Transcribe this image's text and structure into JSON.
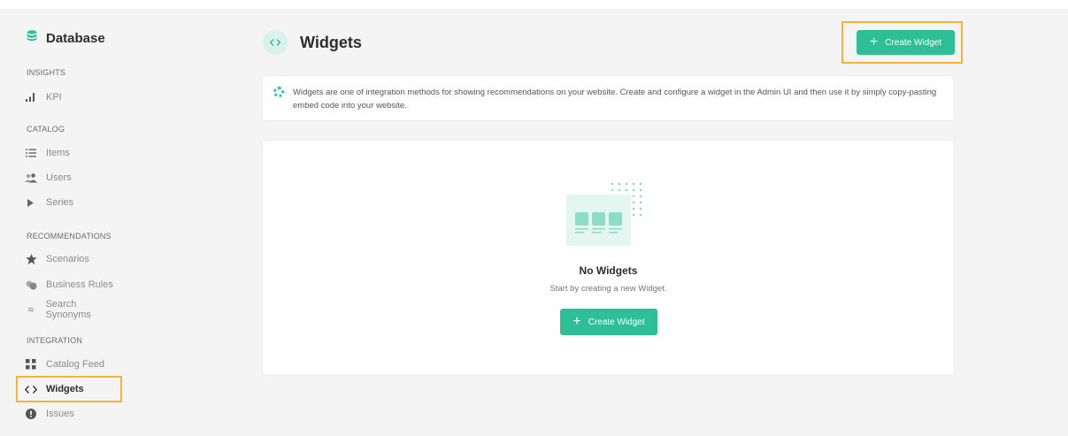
{
  "sidebar": {
    "brand": "Database",
    "sections": {
      "insights": "INSIGHTS",
      "catalog": "CATALOG",
      "recommendations": "RECOMMENDATIONS",
      "integration": "INTEGRATION"
    },
    "items": {
      "kpi": "KPI",
      "items": "Items",
      "users": "Users",
      "series": "Series",
      "scenarios": "Scenarios",
      "business_rules": "Business Rules",
      "search_synonyms": "Search Synonyms",
      "catalog_feed": "Catalog Feed",
      "widgets": "Widgets",
      "issues": "Issues"
    },
    "active_item": "Widgets"
  },
  "header": {
    "title": "Widgets",
    "create_button": "Create Widget"
  },
  "info": {
    "text": "Widgets are one of integration methods for showing recommendations on your website. Create and configure a widget in the Admin UI and then use it by simply copy-pasting embed code into your website."
  },
  "empty_state": {
    "title": "No Widgets",
    "subtitle": "Start by creating a new Widget.",
    "create_button": "Create Widget"
  },
  "colors": {
    "accent": "#2fbf96",
    "highlight": "#f5b335",
    "background": "#f4f4f4"
  }
}
